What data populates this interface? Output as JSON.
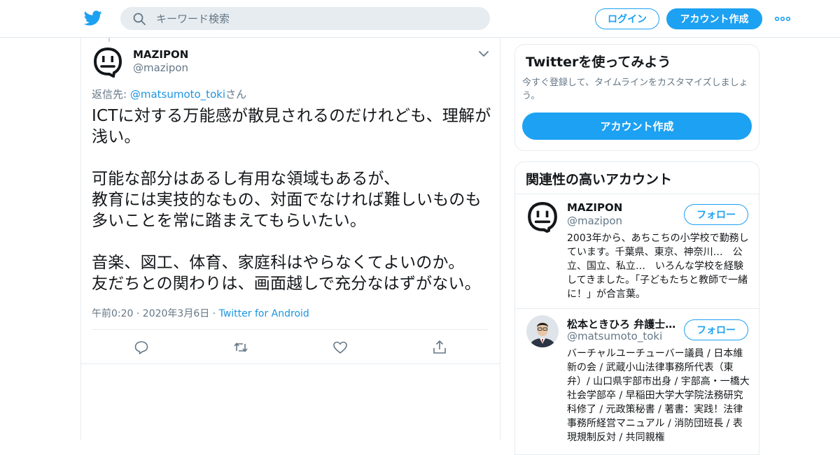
{
  "header": {
    "search_placeholder": "キーワード検索",
    "login_label": "ログイン",
    "signup_label": "アカウント作成"
  },
  "tweet": {
    "name": "MAZIPON",
    "handle": "@mazipon",
    "reply_prefix": "返信先: ",
    "reply_to": "@matsumoto_toki",
    "reply_suffix": "さん",
    "text": "ICTに対する万能感が散見されるのだけれども、理解が浅い。\n\n可能な部分はあるし有用な領域もあるが、\n教育には実技的なもの、対面でなければ難しいものも多いことを常に踏まえてもらいたい。\n\n音楽、図工、体育、家庭科はやらなくてよいのか。\n友だちとの関わりは、画面越しで充分なはずがない。",
    "timestamp": "午前0:20 · 2020年3月6日",
    "separator": " · ",
    "source": "Twitter for Android"
  },
  "signup_card": {
    "title": "Twitterを使ってみよう",
    "description": "今すぐ登録して、タイムラインをカスタマイズしましょう。",
    "button_label": "アカウント作成"
  },
  "related": {
    "title": "関連性の高いアカウント",
    "accounts": [
      {
        "name": "MAZIPON",
        "handle": "@mazipon",
        "follow_label": "フォロー",
        "bio": "2003年から、あちこちの小学校で勤務しています。千葉県、東京、神奈川…　公立、国立、私立…　いろんな学校を経験してきました。「子どもたちと教師で一緒に！」が合言葉。"
      },
      {
        "name": "松本ときひろ 弁護士…",
        "handle": "@matsumoto_toki",
        "follow_label": "フォロー",
        "bio": "バーチャルユーチューバー議員 / 日本維新の会 / 武蔵小山法律事務所代表（東弁）/ 山口県宇部市出身 / 宇部高・一橋大社会学部卒 / 早稲田大学大学院法務研究科修了 / 元政策秘書 / 著書：実践！法律事務所経営マニュアル / 消防団班長 / 表現規制反対 / 共同親権"
      }
    ]
  },
  "colors": {
    "accent": "#1da1f2",
    "link": "#1b95e0",
    "muted": "#657786"
  },
  "icons": [
    "twitter-bird-icon",
    "search-icon",
    "more-dots-icon",
    "chevron-down-icon",
    "reply-icon",
    "retweet-icon",
    "like-icon",
    "share-icon"
  ]
}
